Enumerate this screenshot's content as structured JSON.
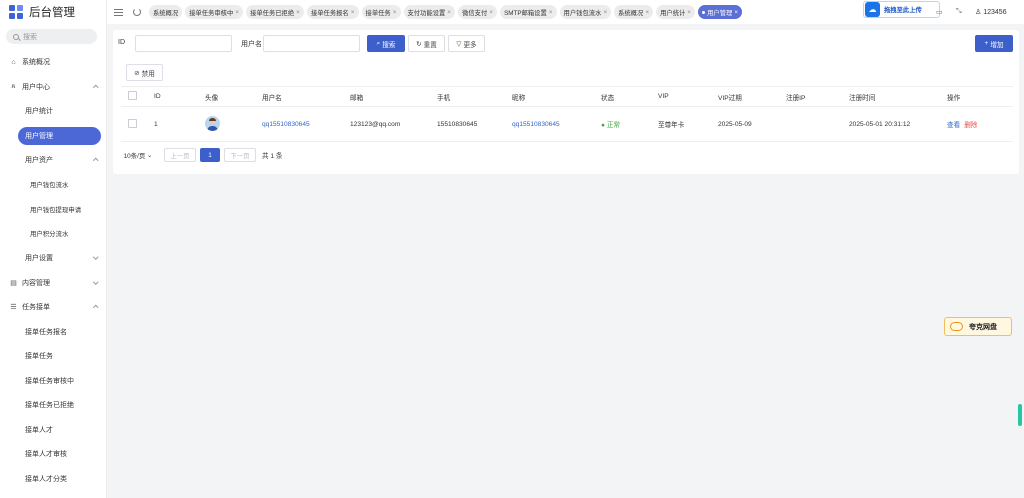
{
  "app": {
    "title": "后台管理"
  },
  "sidebar": {
    "search_placeholder": "搜索",
    "items": [
      {
        "label": "系统概况",
        "level": 0,
        "icon": "home-icon"
      },
      {
        "label": "用户中心",
        "level": 0,
        "icon": "users-icon",
        "expanded": true
      },
      {
        "label": "用户统计",
        "level": 1
      },
      {
        "label": "用户管理",
        "level": 1,
        "active": true
      },
      {
        "label": "用户资产",
        "level": 1,
        "expanded": true
      },
      {
        "label": "用户钱包流水",
        "level": 2
      },
      {
        "label": "用户钱包提现申请",
        "level": 2
      },
      {
        "label": "用户积分流水",
        "level": 2
      },
      {
        "label": "用户设置",
        "level": 1
      },
      {
        "label": "内容管理",
        "level": 0,
        "icon": "document-icon"
      },
      {
        "label": "任务接单",
        "level": 0,
        "icon": "list-icon",
        "expanded": true
      },
      {
        "label": "接单任务报名",
        "level": 1
      },
      {
        "label": "接单任务",
        "level": 1
      },
      {
        "label": "接单任务审核中",
        "level": 1
      },
      {
        "label": "接单任务已拒绝",
        "level": 1
      },
      {
        "label": "接单人才",
        "level": 1
      },
      {
        "label": "接单人才审核",
        "level": 1
      },
      {
        "label": "接单人才分类",
        "level": 1
      }
    ]
  },
  "topbar": {
    "tabs": [
      {
        "label": "系统概况",
        "closable": false
      },
      {
        "label": "接单任务审核中",
        "closable": true
      },
      {
        "label": "接单任务已拒绝",
        "closable": true
      },
      {
        "label": "接单任务报名",
        "closable": true
      },
      {
        "label": "接单任务",
        "closable": true
      },
      {
        "label": "支付功能设置",
        "closable": true
      },
      {
        "label": "微信支付",
        "closable": true
      },
      {
        "label": "SMTP邮箱设置",
        "closable": true
      },
      {
        "label": "用户钱包流水",
        "closable": true
      },
      {
        "label": "系统概况",
        "closable": true
      },
      {
        "label": "用户统计",
        "closable": true
      },
      {
        "label": "用户管理",
        "closable": true,
        "active": true
      }
    ],
    "upload_label": "拖拽至此上传",
    "username": "123456"
  },
  "filters": {
    "id_label": "ID",
    "username_label": "用户名",
    "search_button": "搜索",
    "reset_button": "重置",
    "more_button": "更多",
    "add_button": "增加",
    "disable_button": "禁用"
  },
  "table": {
    "columns": [
      "ID",
      "头像",
      "用户名",
      "邮箱",
      "手机",
      "昵称",
      "状态",
      "VIP",
      "VIP过期",
      "注册IP",
      "注册时间",
      "操作"
    ],
    "rows": [
      {
        "id": "1",
        "username": "qq15510830645",
        "email": "123123@qq.com",
        "phone": "15510830645",
        "nickname": "qq15510830645",
        "status": "正常",
        "vip": "至尊年卡",
        "vip_expire": "2025-05-09",
        "reg_ip": "",
        "reg_time": "2025-05-01 20:31:12",
        "view_action": "查看",
        "delete_action": "删除"
      }
    ]
  },
  "pagination": {
    "page_size": "10条/页",
    "prev": "上一页",
    "current": "1",
    "next": "下一页",
    "total": "共 1 条"
  },
  "floating": {
    "label": "夸克网盘"
  },
  "colors": {
    "primary": "#3d5fcc",
    "active_tab": "#5b6fd6",
    "status_ok": "#41a841",
    "danger": "#e05050",
    "link": "#3366cc"
  }
}
